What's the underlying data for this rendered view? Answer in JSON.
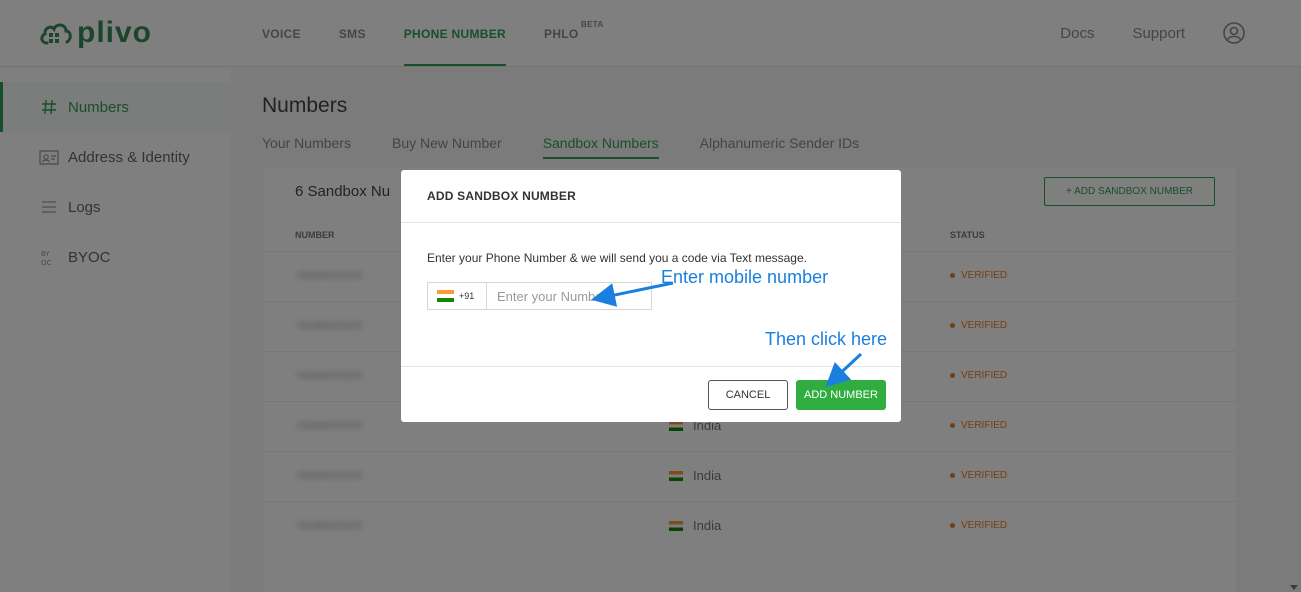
{
  "brand": {
    "logo_text": "plivo",
    "primary_color": "#2f9e57"
  },
  "topnav": {
    "items": [
      {
        "label": "VOICE"
      },
      {
        "label": "SMS"
      },
      {
        "label": "PHONE NUMBER",
        "active": true
      },
      {
        "label": "PHLO",
        "badge": "BETA"
      }
    ],
    "docs_label": "Docs",
    "support_label": "Support",
    "user_icon": "user-circle-icon"
  },
  "sidebar": {
    "items": [
      {
        "label": "Numbers",
        "icon": "hash-icon",
        "active": true
      },
      {
        "label": "Address & Identity",
        "icon": "id-card-icon"
      },
      {
        "label": "Logs",
        "icon": "list-icon"
      },
      {
        "label": "BYOC",
        "icon": "byoc-icon"
      }
    ]
  },
  "page": {
    "title": "Numbers",
    "tabs": [
      {
        "label": "Your Numbers"
      },
      {
        "label": "Buy New Number"
      },
      {
        "label": "Sandbox Numbers",
        "active": true
      },
      {
        "label": "Alphanumeric Sender IDs"
      }
    ],
    "count_label": "6 Sandbox Nu",
    "add_button": "+ ADD SANDBOX NUMBER",
    "table": {
      "headers": [
        "NUMBER",
        "STATUS"
      ],
      "rows": [
        {
          "number": "+9194XXXXX",
          "country": "",
          "status": "VERIFIED"
        },
        {
          "number": "+9194XXXXX",
          "country": "",
          "status": "VERIFIED"
        },
        {
          "number": "+9194XXXXX",
          "country": "",
          "status": "VERIFIED"
        },
        {
          "number": "+9194XXXXX",
          "country": "India",
          "status": "VERIFIED"
        },
        {
          "number": "+9194XXXXX",
          "country": "India",
          "status": "VERIFIED"
        },
        {
          "number": "+9194XXXXX",
          "country": "India",
          "status": "VERIFIED"
        }
      ]
    }
  },
  "modal": {
    "title": "ADD SANDBOX NUMBER",
    "description": "Enter your Phone Number & we will send you a code via Text message.",
    "country_code": "+91",
    "phone_placeholder": "Enter your Number",
    "phone_value": "",
    "cancel_label": "CANCEL",
    "add_label": "ADD NUMBER",
    "add_color": "#2fae3f"
  },
  "annotations": {
    "enter_number": "Enter mobile number",
    "click_here": "Then click here",
    "color": "#1a7fe0"
  }
}
